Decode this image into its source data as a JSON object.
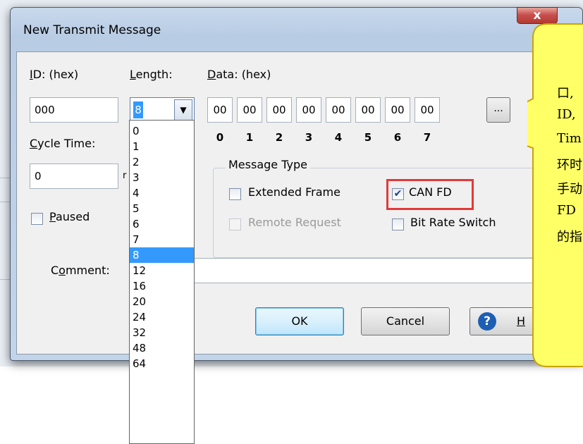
{
  "window": {
    "title": "New Transmit Message",
    "close_label": "x"
  },
  "id_field": {
    "label": "ID: (hex)",
    "label_key": "I",
    "label_rest": "D: (hex)",
    "value": "000"
  },
  "length_field": {
    "label_key": "L",
    "label_rest": "ength:",
    "value": "8"
  },
  "data_field": {
    "label_key": "D",
    "label_rest": "ata: (hex)",
    "bytes": [
      "00",
      "00",
      "00",
      "00",
      "00",
      "00",
      "00",
      "00"
    ],
    "indices": [
      "0",
      "1",
      "2",
      "3",
      "4",
      "5",
      "6",
      "7"
    ],
    "more_label": "..."
  },
  "cycle_time": {
    "label_key": "C",
    "label_rest": "ycle Time:",
    "value": "0",
    "unit_partial": "r"
  },
  "paused": {
    "label_key": "P",
    "label_rest": "aused",
    "checked": false
  },
  "message_type": {
    "title": "Message Type",
    "extended_frame": {
      "label": "Extended Frame",
      "checked": false
    },
    "can_fd": {
      "label": "CAN FD",
      "checked": true
    },
    "remote_request": {
      "label": "Remote Request",
      "checked": false,
      "disabled": true
    },
    "bit_rate_switch": {
      "label": "Bit Rate Switch",
      "checked": false
    }
  },
  "comment": {
    "label_pre": "C",
    "label_key": "o",
    "label_rest": "mment:",
    "value": ""
  },
  "buttons": {
    "ok": "OK",
    "cancel": "Cancel",
    "help_partial": "H"
  },
  "length_dropdown": {
    "options": [
      "0",
      "1",
      "2",
      "3",
      "4",
      "5",
      "6",
      "7",
      "8",
      "12",
      "16",
      "20",
      "24",
      "32",
      "48",
      "64"
    ],
    "selected": "8"
  },
  "callout": {
    "lines": [
      "口,",
      "ID,",
      "Tim",
      "环时",
      "手动",
      "FD",
      "的指"
    ]
  },
  "colors": {
    "selection": "#3399ff",
    "highlight_box": "#e23a3a",
    "callout_fill": "#ffff66"
  }
}
